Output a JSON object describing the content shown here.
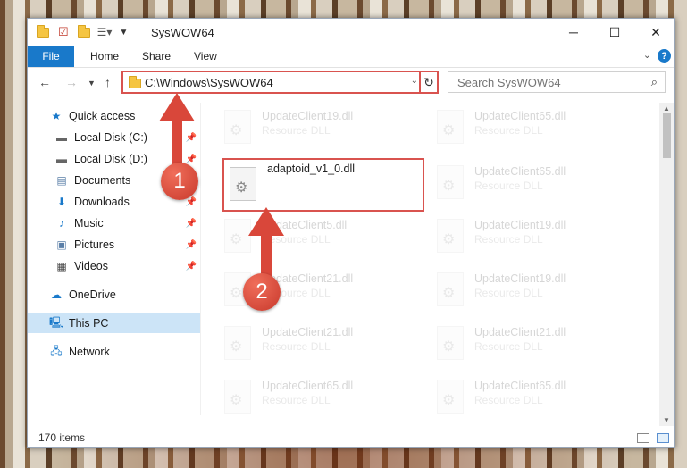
{
  "window": {
    "title": "SysWOW64",
    "controls": {
      "minimize": "─",
      "maximize": "☐",
      "close": "✕"
    }
  },
  "ribbon": {
    "file": "File",
    "tabs": [
      "Home",
      "Share",
      "View"
    ],
    "help": "?"
  },
  "address": {
    "path": "C:\\Windows\\SysWOW64",
    "search_placeholder": "Search SysWOW64"
  },
  "nav": {
    "items": [
      {
        "label": "Quick access",
        "icon": "star-icon"
      },
      {
        "label": "Local Disk (C:)",
        "icon": "drive-icon"
      },
      {
        "label": "Local Disk (D:)",
        "icon": "drive-icon"
      },
      {
        "label": "Documents",
        "icon": "documents-icon"
      },
      {
        "label": "Downloads",
        "icon": "download-icon"
      },
      {
        "label": "Music",
        "icon": "music-icon"
      },
      {
        "label": "Pictures",
        "icon": "pictures-icon"
      },
      {
        "label": "Videos",
        "icon": "videos-icon"
      },
      {
        "label": "OneDrive",
        "icon": "cloud-icon"
      },
      {
        "label": "This PC",
        "icon": "computer-icon"
      },
      {
        "label": "Network",
        "icon": "network-icon"
      }
    ]
  },
  "files": {
    "highlighted": {
      "name": "adaptoid_v1_0.dll"
    },
    "left": [
      {
        "name": "UpdateClient19.dll",
        "type": "Resource DLL"
      },
      {
        "name": "UpdateClient5.dll",
        "type": "Resource DLL"
      },
      {
        "name": "UpdateClient21.dll",
        "type": "Resource DLL"
      },
      {
        "name": "UpdateClient21.dll",
        "type": "Resource DLL"
      },
      {
        "name": "UpdateClient65.dll",
        "type": "Resource DLL"
      }
    ],
    "right": [
      {
        "name": "UpdateClient65.dll",
        "type": "Resource DLL"
      },
      {
        "name": "UpdateClient65.dll",
        "type": "Resource DLL"
      },
      {
        "name": "UpdateClient19.dll",
        "type": "Resource DLL"
      },
      {
        "name": "UpdateClient19.dll",
        "type": "Resource DLL"
      },
      {
        "name": "UpdateClient21.dll",
        "type": "Resource DLL"
      },
      {
        "name": "UpdateClient65.dll",
        "type": "Resource DLL"
      }
    ]
  },
  "status": {
    "item_count": "170 items"
  },
  "callouts": [
    "1",
    "2"
  ],
  "colors": {
    "accent": "#1979ca",
    "highlight": "#d9534f",
    "selection": "#cce4f7"
  }
}
